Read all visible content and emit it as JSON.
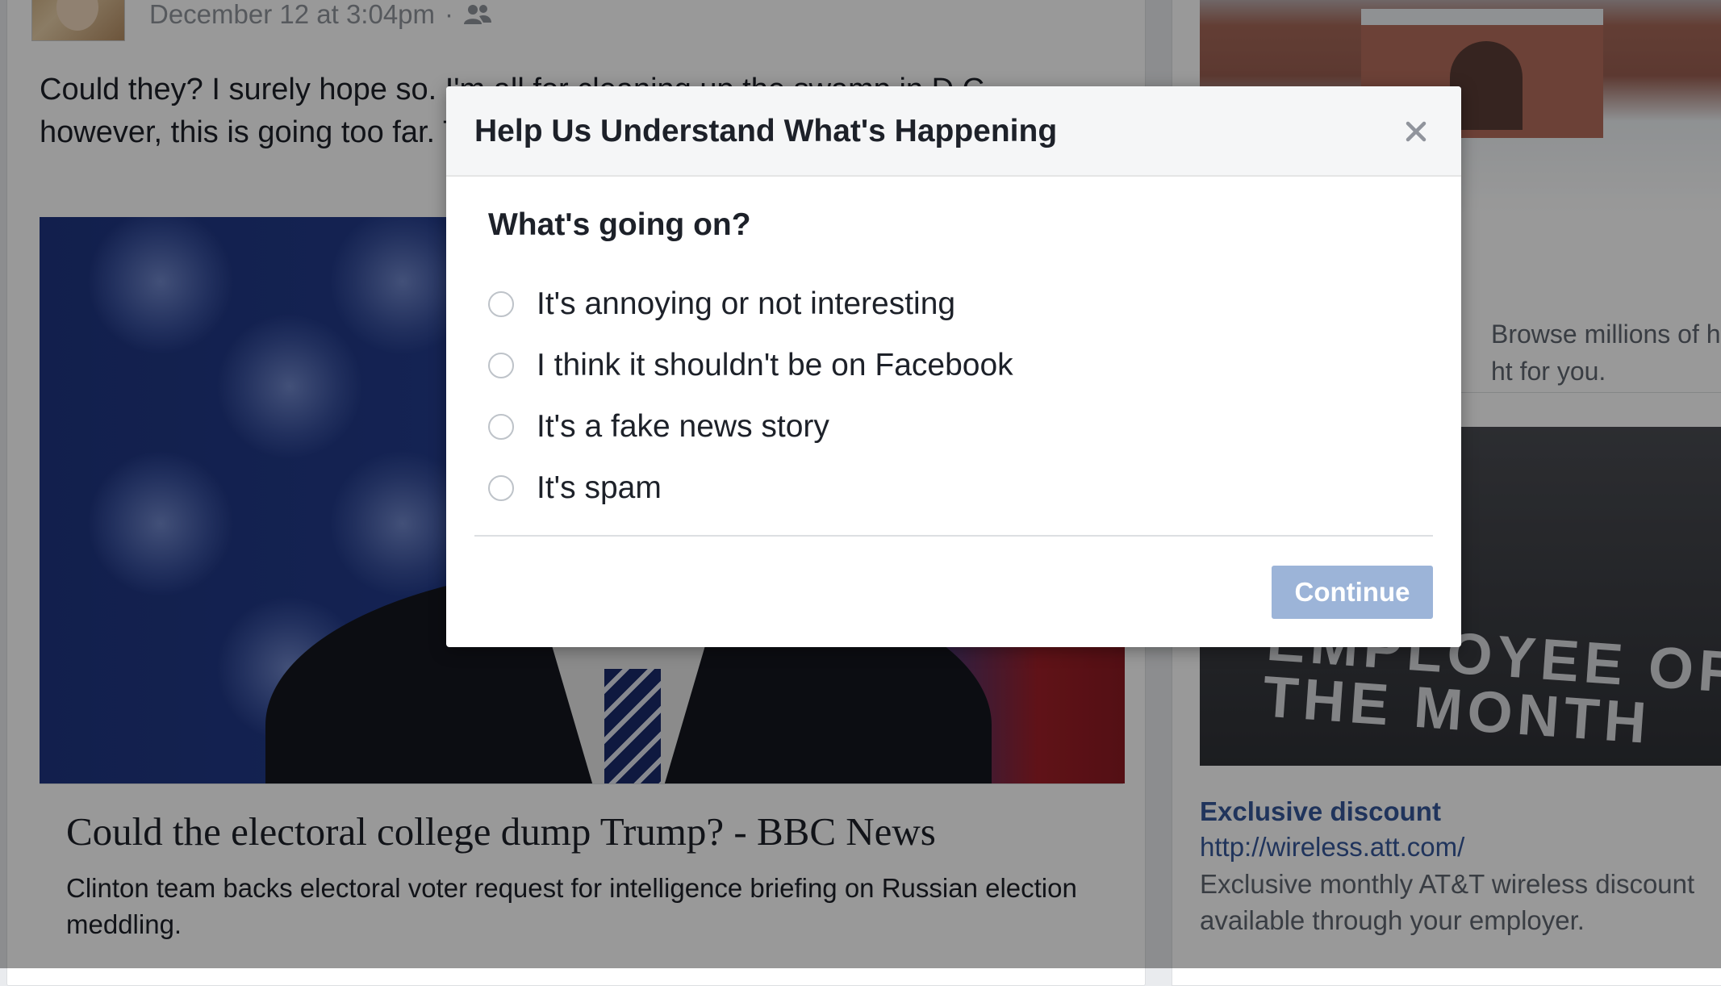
{
  "post": {
    "timestamp": "December 12 at 3:04pm",
    "separator": "·",
    "audience_icon": "friends-icon",
    "text": "Could they? I surely hope so. I'm all for cleaning up the swamp in D.C., however, this is going too far. Trump's picks say it all.",
    "link": {
      "title": "Could the electoral college dump Trump? - BBC News",
      "description": "Clinton team backs electoral voter request for intelligence briefing on Russian election meddling."
    }
  },
  "sidebar": {
    "ad_fragment": "Browse millions of ho\nht for you.",
    "image_text": "EMPLOYEE OF\nTHE MONTH",
    "ad": {
      "title": "Exclusive discount",
      "url": "http://wireless.att.com/",
      "description": "Exclusive monthly AT&T wireless discount\navailable through your employer."
    }
  },
  "dialog": {
    "title": "Help Us Understand What's Happening",
    "close_icon": "close-icon",
    "question": "What's going on?",
    "options": [
      {
        "label": "It's annoying or not interesting",
        "selected": false
      },
      {
        "label": "I think it shouldn't be on Facebook",
        "selected": false
      },
      {
        "label": "It's a fake news story",
        "selected": false
      },
      {
        "label": "It's spam",
        "selected": false
      }
    ],
    "continue_label": "Continue",
    "continue_enabled": false
  },
  "colors": {
    "link_blue": "#365899",
    "button_disabled": "#9cb4d8",
    "text": "#1d2129",
    "meta_gray": "#90949c"
  }
}
